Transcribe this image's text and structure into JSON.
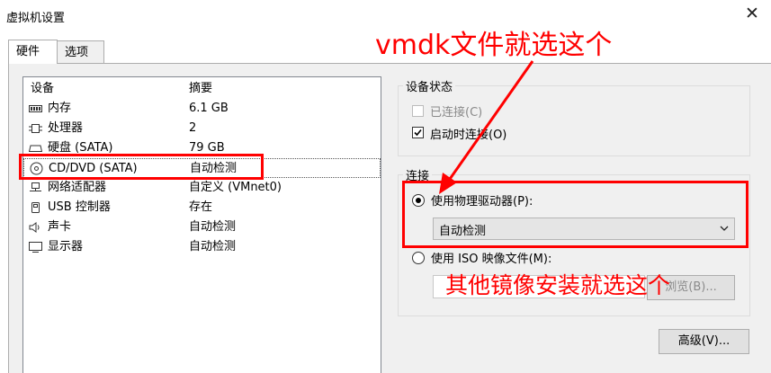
{
  "window": {
    "title": "虚拟机设置",
    "close_glyph": "✕"
  },
  "tabs": [
    {
      "label": "硬件",
      "active": true
    },
    {
      "label": "选项",
      "active": false
    }
  ],
  "device_list": {
    "columns": {
      "device": "设备",
      "summary": "摘要"
    },
    "rows": [
      {
        "icon": "memory-icon",
        "name": "内存",
        "summary": "6.1 GB"
      },
      {
        "icon": "processor-icon",
        "name": "处理器",
        "summary": "2"
      },
      {
        "icon": "hard-disk-icon",
        "name": "硬盘 (SATA)",
        "summary": "79 GB"
      },
      {
        "icon": "cd-dvd-icon",
        "name": "CD/DVD (SATA)",
        "summary": "自动检测",
        "selected": true
      },
      {
        "icon": "network-adapter-icon",
        "name": "网络适配器",
        "summary": "自定义 (VMnet0)"
      },
      {
        "icon": "usb-icon",
        "name": "USB 控制器",
        "summary": "存在"
      },
      {
        "icon": "sound-card-icon",
        "name": "声卡",
        "summary": "自动检测"
      },
      {
        "icon": "display-icon",
        "name": "显示器",
        "summary": "自动检测"
      }
    ]
  },
  "device_status": {
    "legend": "设备状态",
    "connected": {
      "label": "已连接(C)",
      "checked": false,
      "disabled": true
    },
    "connect_at_power_on": {
      "label": "启动时连接(O)",
      "checked": true
    }
  },
  "connection": {
    "legend": "连接",
    "physical_drive": {
      "label": "使用物理驱动器(P):",
      "selected": true
    },
    "drive_select": {
      "value": "自动检测"
    },
    "iso_image": {
      "label": "使用 ISO 映像文件(M):",
      "selected": false
    },
    "browse_button": {
      "label": "浏览(B)..."
    }
  },
  "advanced_button": {
    "label": "高级(V)..."
  },
  "annotations": {
    "top": "vmdk文件就选这个",
    "bottom": "其他镜像安装就选这个",
    "color": "#ff0000"
  }
}
